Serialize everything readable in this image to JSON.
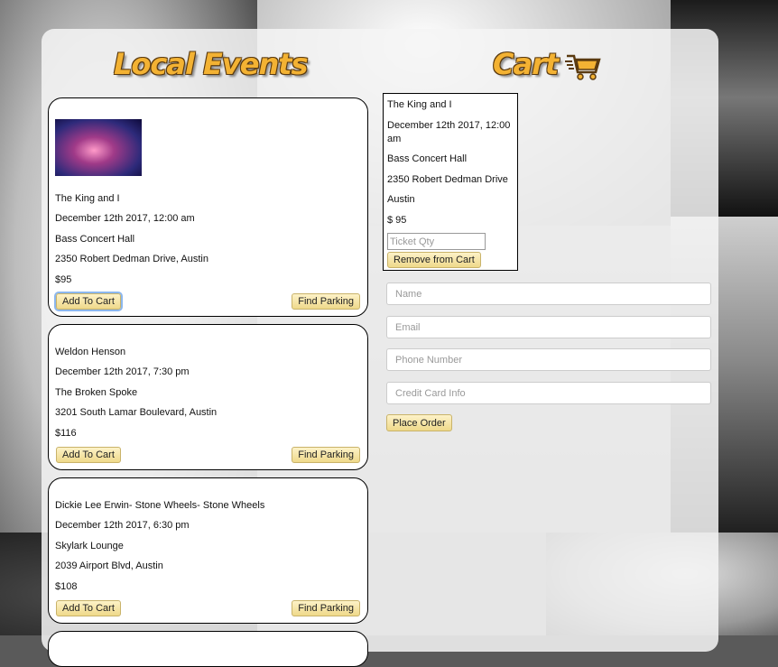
{
  "header": {
    "events_title": "Local Events",
    "cart_title": "Cart"
  },
  "events": [
    {
      "name": "The King and I",
      "date": "December 12th 2017, 12:00 am",
      "venue": "Bass Concert Hall",
      "address": "2350 Robert Dedman Drive, Austin",
      "price": "$95",
      "add_label": "Add To Cart",
      "parking_label": "Find Parking",
      "has_image": true
    },
    {
      "name": "Weldon Henson",
      "date": "December 12th 2017, 7:30 pm",
      "venue": "The Broken Spoke",
      "address": "3201 South Lamar Boulevard, Austin",
      "price": "$116",
      "add_label": "Add To Cart",
      "parking_label": "Find Parking"
    },
    {
      "name": "Dickie Lee Erwin- Stone Wheels- Stone Wheels",
      "date": "December 12th 2017, 6:30 pm",
      "venue": "Skylark Lounge",
      "address": "2039 Airport Blvd, Austin",
      "price": "$108",
      "add_label": "Add To Cart",
      "parking_label": "Find Parking"
    }
  ],
  "cart": {
    "item": {
      "name": "The King and I",
      "date_line1": "December 12th 2017, 12:00",
      "date_line2": "am",
      "venue": "Bass Concert Hall",
      "street": "2350 Robert Dedman Drive",
      "city": "Austin",
      "price": "$ 95",
      "qty_placeholder": "Ticket Qty",
      "remove_label": "Remove from Cart"
    },
    "form": {
      "name_placeholder": "Name",
      "email_placeholder": "Email",
      "phone_placeholder": "Phone Number",
      "card_placeholder": "Credit Card Info",
      "submit_label": "Place Order"
    }
  },
  "colors": {
    "title": "#f3b233",
    "button": "#f5e4a6",
    "focus": "#8cb7ee"
  },
  "icons": {
    "cart": "shopping-cart-icon"
  }
}
